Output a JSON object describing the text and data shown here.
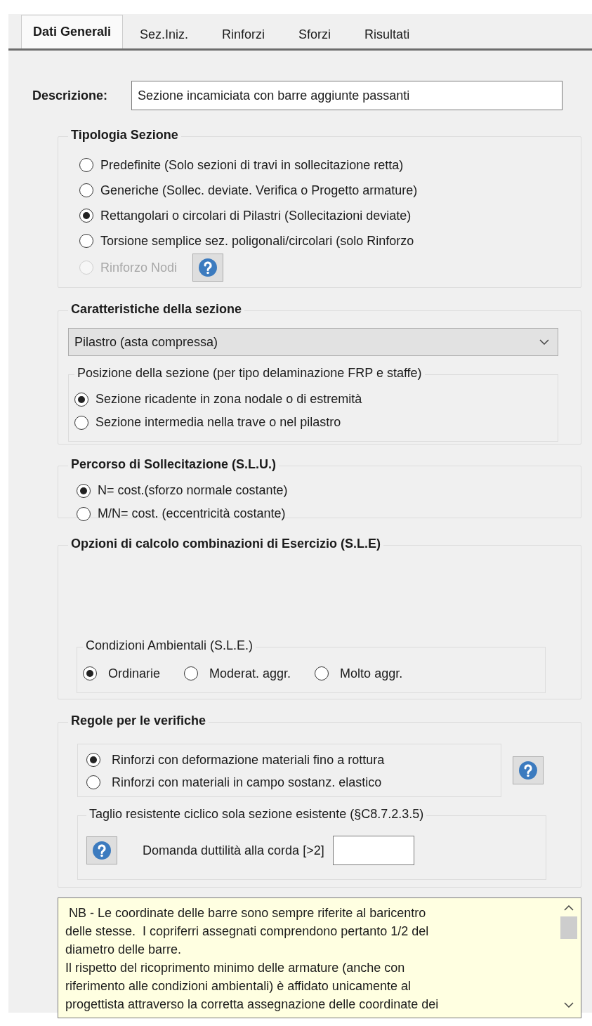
{
  "tabs": [
    {
      "label": "Dati Generali",
      "selected": true
    },
    {
      "label": "Sez.Iniz.",
      "selected": false
    },
    {
      "label": "Rinforzi",
      "selected": false
    },
    {
      "label": "Sforzi",
      "selected": false
    },
    {
      "label": "Risultati",
      "selected": false
    }
  ],
  "description": {
    "label": "Descrizione:",
    "value": "Sezione incamiciata con barre aggiunte passanti"
  },
  "tipologia": {
    "title": "Tipologia Sezione",
    "options": [
      {
        "label": "Predefinite (Solo sezioni di travi in sollecitazione retta)",
        "selected": false,
        "disabled": false,
        "has_help": false
      },
      {
        "label": "Generiche (Sollec. deviate. Verifica o Progetto armature)",
        "selected": false,
        "disabled": false,
        "has_help": false
      },
      {
        "label": "Rettangolari o circolari di Pilastri (Sollecitazioni deviate)",
        "selected": true,
        "disabled": false,
        "has_help": false
      },
      {
        "label": "Torsione semplice sez. poligonali/circolari (solo Rinforzo",
        "selected": false,
        "disabled": false,
        "has_help": false
      },
      {
        "label": "Rinforzo Nodi",
        "selected": false,
        "disabled": true,
        "has_help": true
      }
    ]
  },
  "caratteristiche": {
    "title": "Caratteristiche della sezione",
    "select_value": "Pilastro (asta compressa)",
    "posizione": {
      "title": "Posizione della sezione (per tipo delaminazione FRP e staffe)",
      "options": [
        {
          "label": "Sezione ricadente in zona nodale o di estremità",
          "selected": true
        },
        {
          "label": "Sezione intermedia nella trave o nel pilastro",
          "selected": false
        }
      ]
    }
  },
  "percorso": {
    "title": "Percorso di Sollecitazione (S.L.U.)",
    "options": [
      {
        "label": "N= cost.(sforzo normale costante)",
        "selected": true
      },
      {
        "label": "M/N= cost. (eccentricità costante)",
        "selected": false
      }
    ]
  },
  "opzioni_sle": {
    "title": "Opzioni di calcolo combinazioni di Esercizio (S.L.E)",
    "condizioni": {
      "title": "Condizioni Ambientali (S.L.E.)",
      "options": [
        {
          "label": "Ordinarie",
          "selected": true
        },
        {
          "label": "Moderat. aggr.",
          "selected": false
        },
        {
          "label": "Molto aggr.",
          "selected": false
        }
      ]
    }
  },
  "regole": {
    "title": "Regole per le verifiche",
    "options": [
      {
        "label": "Rinforzi con deformazione materiali fino a rottura",
        "selected": true
      },
      {
        "label": "Rinforzi con materiali in campo sostanz. elastico",
        "selected": false
      }
    ],
    "taglio": {
      "title": "Taglio resistente ciclico sola sezione esistente (§C8.7.2.3.5)",
      "field_label": "Domanda duttilità alla corda [>2]"
    }
  },
  "note": {
    "lines": [
      " NB - Le coordinate delle barre sono sempre riferite al baricentro",
      "delle stesse.  I copriferri assegnati comprendono pertanto 1/2 del",
      "diametro delle barre.",
      "Il rispetto del ricoprimento minimo delle armature (anche con",
      "riferimento alle condizioni ambientali) è affidato unicamente al",
      "progettista attraverso la corretta assegnazione delle coordinate dei"
    ]
  }
}
